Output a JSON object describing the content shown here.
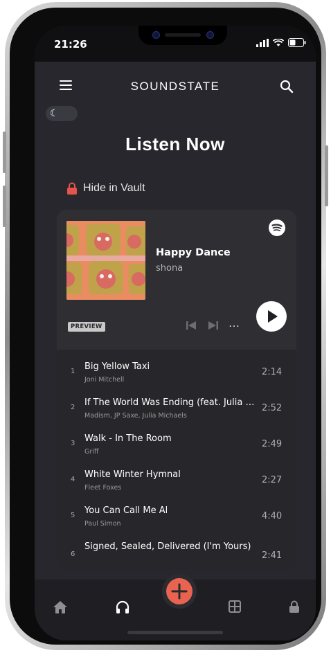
{
  "status_bar": {
    "time": "21:26"
  },
  "header": {
    "title": "SOUNDSTATE"
  },
  "page": {
    "title": "Listen Now"
  },
  "vault": {
    "label": "Hide in Vault"
  },
  "now_playing": {
    "title": "Happy Dance",
    "artist": "shona",
    "badge": "PREVIEW",
    "more": "…"
  },
  "tracks": [
    {
      "num": "1",
      "title": "Big Yellow Taxi",
      "artist": "Joni Mitchell",
      "duration": "2:14"
    },
    {
      "num": "2",
      "title": "If The World Was Ending (feat. Julia Michaels)",
      "artist": "Madism, JP Saxe, Julia Michaels",
      "duration": "2:52"
    },
    {
      "num": "3",
      "title": "Walk - In The Room",
      "artist": "Griff",
      "duration": "2:49"
    },
    {
      "num": "4",
      "title": "White Winter Hymnal",
      "artist": "Fleet Foxes",
      "duration": "2:27"
    },
    {
      "num": "5",
      "title": "You Can Call Me Al",
      "artist": "Paul Simon",
      "duration": "4:40"
    },
    {
      "num": "6",
      "title": "Signed, Sealed, Delivered (I'm Yours)",
      "artist": "",
      "duration": "2:41"
    }
  ],
  "colors": {
    "accent": "#e86450",
    "background": "#27272d",
    "spotify": "#ffffff"
  },
  "icons": [
    "menu-icon",
    "search-icon",
    "moon-icon",
    "lock-icon",
    "spotify-icon",
    "previous-icon",
    "next-icon",
    "more-icon",
    "play-icon",
    "home-icon",
    "headphones-icon",
    "add-icon",
    "grid-icon",
    "lock-icon"
  ]
}
